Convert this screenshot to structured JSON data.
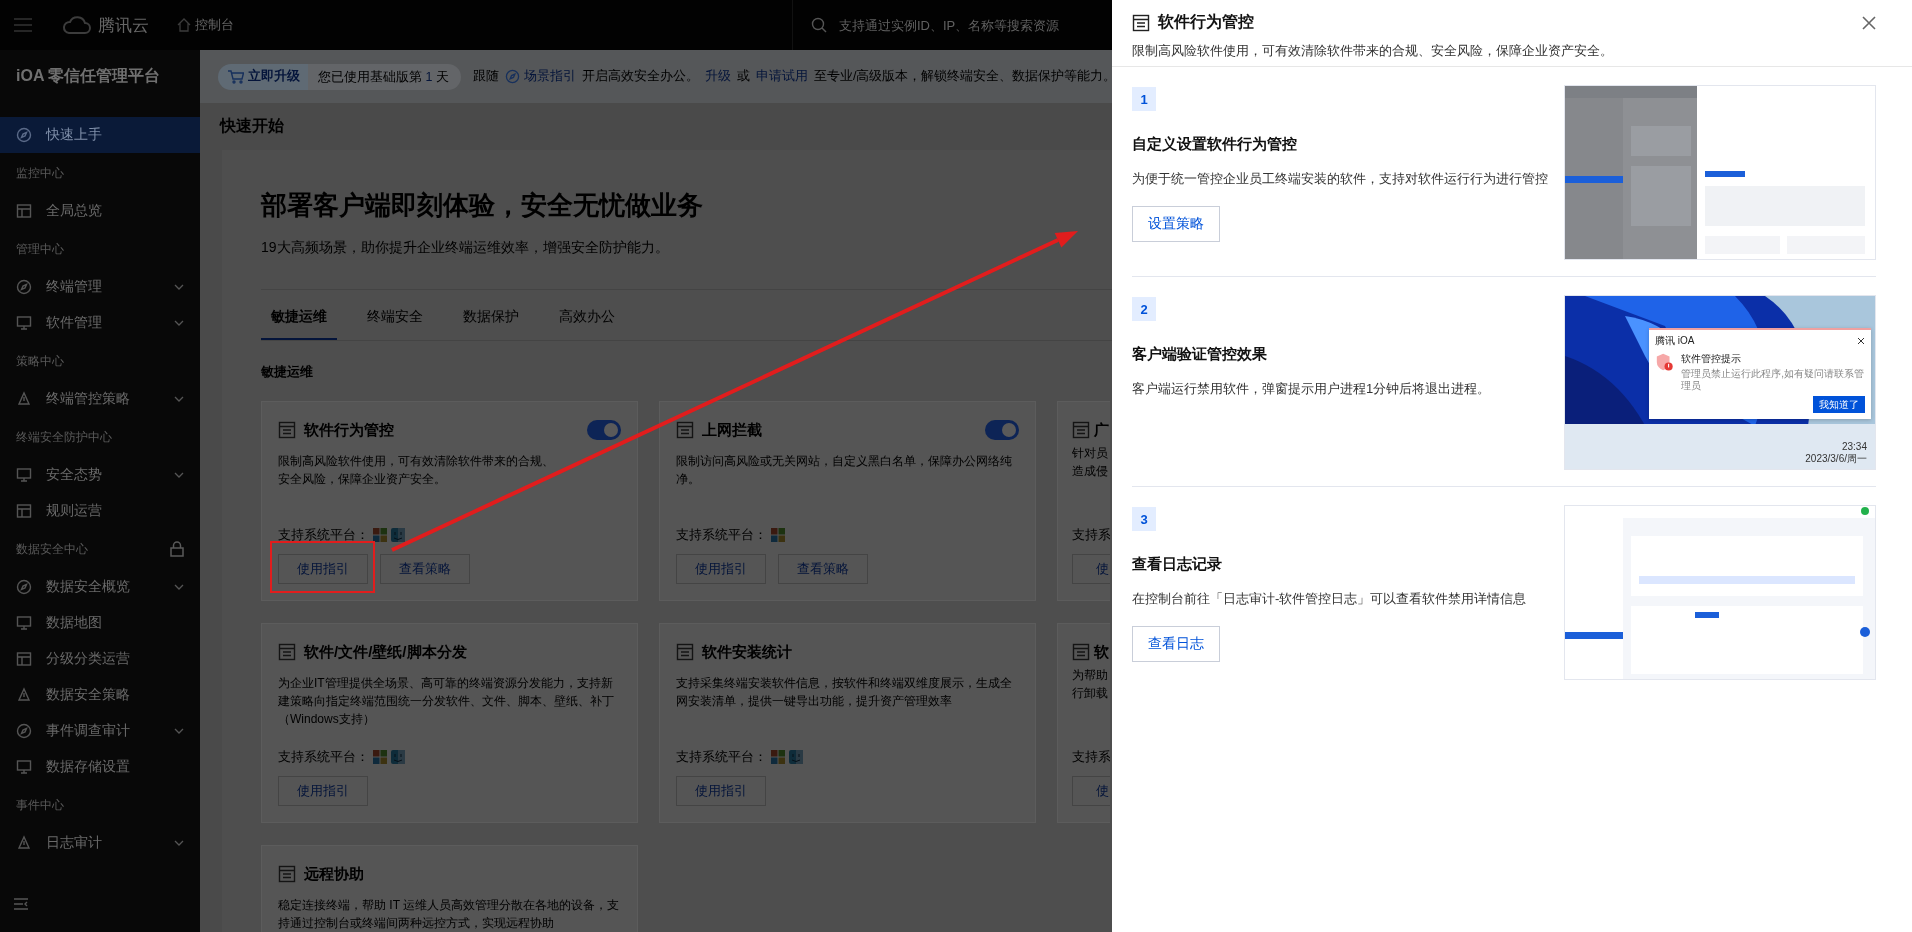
{
  "topbar": {
    "brand": "腾讯云",
    "console": "控制台",
    "search": {
      "placeholder": "支持通过实例ID、IP、名称等搜索资源"
    }
  },
  "sidebar": {
    "title": "iOA 零信任管理平台",
    "items": [
      {
        "kind": "item",
        "label": "快速上手",
        "selected": true,
        "expandable": false
      },
      {
        "kind": "group",
        "label": "监控中心",
        "locked": false
      },
      {
        "kind": "item",
        "label": "全局总览",
        "selected": false,
        "expandable": false
      },
      {
        "kind": "group",
        "label": "管理中心",
        "locked": false
      },
      {
        "kind": "item",
        "label": "终端管理",
        "selected": false,
        "expandable": true
      },
      {
        "kind": "item",
        "label": "软件管理",
        "selected": false,
        "expandable": true
      },
      {
        "kind": "group",
        "label": "策略中心",
        "locked": false
      },
      {
        "kind": "item",
        "label": "终端管控策略",
        "selected": false,
        "expandable": true
      },
      {
        "kind": "group",
        "label": "终端安全防护中心",
        "locked": false
      },
      {
        "kind": "item",
        "label": "安全态势",
        "selected": false,
        "expandable": true
      },
      {
        "kind": "item",
        "label": "规则运营",
        "selected": false,
        "expandable": false
      },
      {
        "kind": "group",
        "label": "数据安全中心",
        "locked": true
      },
      {
        "kind": "item",
        "label": "数据安全概览",
        "selected": false,
        "expandable": true
      },
      {
        "kind": "item",
        "label": "数据地图",
        "selected": false,
        "expandable": false
      },
      {
        "kind": "item",
        "label": "分级分类运营",
        "selected": false,
        "expandable": false
      },
      {
        "kind": "item",
        "label": "数据安全策略",
        "selected": false,
        "expandable": false
      },
      {
        "kind": "item",
        "label": "事件调查审计",
        "selected": false,
        "expandable": true
      },
      {
        "kind": "item",
        "label": "数据存储设置",
        "selected": false,
        "expandable": false
      },
      {
        "kind": "group",
        "label": "事件中心",
        "locked": false
      },
      {
        "kind": "item",
        "label": "日志审计",
        "selected": false,
        "expandable": true
      }
    ]
  },
  "banner": {
    "upgrade_button": "立即升级",
    "trial_prefix": "您已使用基础版第",
    "trial_days": "1",
    "trial_suffix": "天",
    "segments": [
      {
        "kind": "text",
        "text": "跟随"
      },
      {
        "kind": "guide-link",
        "text": "场景指引"
      },
      {
        "kind": "text",
        "text": "开启高效安全办公。"
      },
      {
        "kind": "link",
        "text": "升级"
      },
      {
        "kind": "text",
        "text": "或"
      },
      {
        "kind": "link",
        "text": "申请试用"
      },
      {
        "kind": "text",
        "text": "至专业/高级版本，解锁终端安全、数据保护等能力。"
      }
    ]
  },
  "main": {
    "page_title": "快速开始",
    "hero": {
      "title": "部署客户端即刻体验，安全无忧做业务",
      "subtitle": "19大高频场景，助你提升企业终端运维效率，增强安全防护能力。"
    },
    "tabs": [
      {
        "label": "敏捷运维",
        "selected": true
      },
      {
        "label": "终端安全",
        "selected": false
      },
      {
        "label": "数据保护",
        "selected": false
      },
      {
        "label": "高效办公",
        "selected": false
      }
    ],
    "section_title": "敏捷运维",
    "cards": [
      {
        "kind": "full",
        "title": "软件行为管控",
        "switch_on": true,
        "desc": "限制高风险软件使用，可有效清除软件带来的合规、安全风险，保障企业资产安全。",
        "platform_label": "支持系统平台：",
        "platforms": [
          {
            "kind": "windows"
          },
          {
            "kind": "mac"
          }
        ],
        "buttons": [
          {
            "label": "使用指引",
            "highlighted": true
          },
          {
            "label": "查看策略",
            "highlighted": false
          }
        ]
      },
      {
        "kind": "full",
        "title": "上网拦截",
        "switch_on": true,
        "desc": "限制访问高风险或无关网站，自定义黑白名单，保障办公网络纯净。",
        "platform_label": "支持系统平台：",
        "platforms": [
          {
            "kind": "windows"
          }
        ],
        "buttons": [
          {
            "label": "使用指引",
            "highlighted": false
          },
          {
            "label": "查看策略",
            "highlighted": false
          }
        ]
      },
      {
        "kind": "cut",
        "title": "广",
        "desc_lines": [
          "针对员",
          "造成侵"
        ],
        "platform_label": "支持系",
        "buttons": [
          {
            "label": "使",
            "highlighted": false
          }
        ]
      },
      {
        "kind": "full",
        "title": "软件/文件/壁纸/脚本分发",
        "desc": "为企业IT管理提供全场景、高可靠的终端资源分发能力，支持新建策略向指定终端范围统一分发软件、文件、脚本、壁纸、补丁（Windows支持）",
        "platform_label": "支持系统平台：",
        "platforms": [
          {
            "kind": "windows"
          },
          {
            "kind": "mac"
          }
        ],
        "buttons": [
          {
            "label": "使用指引",
            "highlighted": false
          }
        ]
      },
      {
        "kind": "full",
        "title": "软件安装统计",
        "desc": "支持采集终端安装软件信息，按软件和终端双维度展示，生成全网安装清单，提供一键导出功能，提升资产管理效率",
        "platform_label": "支持系统平台：",
        "platforms": [
          {
            "kind": "windows"
          },
          {
            "kind": "mac"
          }
        ],
        "buttons": [
          {
            "label": "使用指引",
            "highlighted": false
          }
        ]
      },
      {
        "kind": "cut",
        "title": "软",
        "desc_lines": [
          "为帮助",
          "行卸载"
        ],
        "platform_label": "支持系",
        "buttons": [
          {
            "label": "使",
            "highlighted": false
          }
        ]
      },
      {
        "kind": "full",
        "title": "远程协助",
        "desc": "稳定连接终端，帮助 IT 运维人员高效管理分散在各地的设备，支持通过控制台或终端间两种远控方式，实现远程协助"
      }
    ]
  },
  "drawer": {
    "title": "软件行为管控",
    "subtitle": "限制高风险软件使用，可有效清除软件带来的合规、安全风险，保障企业资产安全。",
    "steps": [
      {
        "number": "1",
        "title": "自定义设置软件行为管控",
        "desc": "为便于统一管控企业员工终端安装的软件，支持对软件运行行为进行管控",
        "button": "设置策略"
      },
      {
        "number": "2",
        "title": "客户端验证管控效果",
        "desc": "客户端运行禁用软件，弹窗提示用户进程1分钟后将退出进程。",
        "preview": {
          "kind": "desktop",
          "popup": {
            "app": "腾讯 iOA",
            "title": "软件管控提示",
            "message": "管理员禁止运行此程序,如有疑问请联系管理员",
            "button": "我知道了"
          },
          "time": "23:34",
          "date": "2023/3/6/周一"
        }
      },
      {
        "number": "3",
        "title": "查看日志记录",
        "desc": "在控制台前往「日志审计-软件管控日志」可以查看软件禁用详情信息",
        "button": "查看日志"
      }
    ]
  }
}
